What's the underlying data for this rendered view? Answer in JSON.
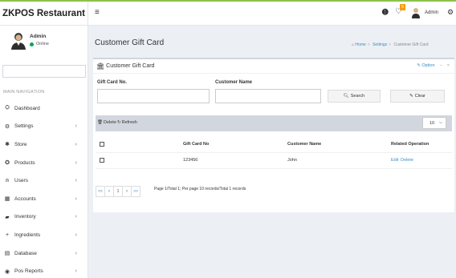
{
  "app": {
    "brand": "ZKPOS Restaurant"
  },
  "user": {
    "name": "Admin",
    "status": "Online"
  },
  "sidebar": {
    "header": "MAIN NAVIGATION",
    "items": [
      {
        "label": "Dashboard",
        "icon": "dashboard-icon",
        "glyph": "⛭",
        "expandable": false
      },
      {
        "label": "Settings",
        "icon": "gear-icon",
        "glyph": "⚙",
        "expandable": true
      },
      {
        "label": "Store",
        "icon": "store-icon",
        "glyph": "✱",
        "expandable": true
      },
      {
        "label": "Products",
        "icon": "products-icon",
        "glyph": "✪",
        "expandable": true
      },
      {
        "label": "Users",
        "icon": "user-icon",
        "glyph": "⍝",
        "expandable": true
      },
      {
        "label": "Accounts",
        "icon": "accounts-icon",
        "glyph": "▦",
        "expandable": true
      },
      {
        "label": "Inventory",
        "icon": "inventory-icon",
        "glyph": "▰",
        "expandable": true
      },
      {
        "label": "Ingredients",
        "icon": "plus-icon",
        "glyph": "+",
        "expandable": true
      },
      {
        "label": "Database",
        "icon": "database-icon",
        "glyph": "▤",
        "expandable": true
      },
      {
        "label": "Pos Reports",
        "icon": "reports-icon",
        "glyph": "◉",
        "expandable": true
      }
    ]
  },
  "header": {
    "menu_glyph": "≡",
    "notification_count": "5",
    "admin_label": "Admin"
  },
  "page": {
    "title": "Customer Gift Card",
    "breadcrumb": [
      "Home",
      "Settings",
      "Customer Gift Card"
    ]
  },
  "box": {
    "title": "Customer Gift Card",
    "option_label": "Option",
    "collapse_glyph": "−",
    "close_glyph": "×"
  },
  "filters": {
    "gift_card_label": "Gift Card No.",
    "gift_card_value": "",
    "customer_label": "Customer Name",
    "customer_value": "",
    "search_label": "Search",
    "clear_label": "Clear"
  },
  "toolbar": {
    "delete_label": "Delete",
    "refresh_label": "Refresh",
    "page_size": "10"
  },
  "table": {
    "columns": [
      "Gift Card No",
      "Customer Name",
      "Related Operation"
    ],
    "rows": [
      {
        "gift_card_no": "123456",
        "customer_name": "John",
        "edit": "Edit",
        "delete": "Delete"
      }
    ]
  },
  "pagination": {
    "first": "<<",
    "prev": "<",
    "current": "1",
    "next": ">",
    "last": ">>",
    "info": "Page 1/Total 1; Per page 10 records/Total 1 records"
  },
  "colors": {
    "accent": "#8bc34a",
    "link": "#3c8dbc",
    "online": "#00a65a",
    "badge": "#f39c12"
  }
}
